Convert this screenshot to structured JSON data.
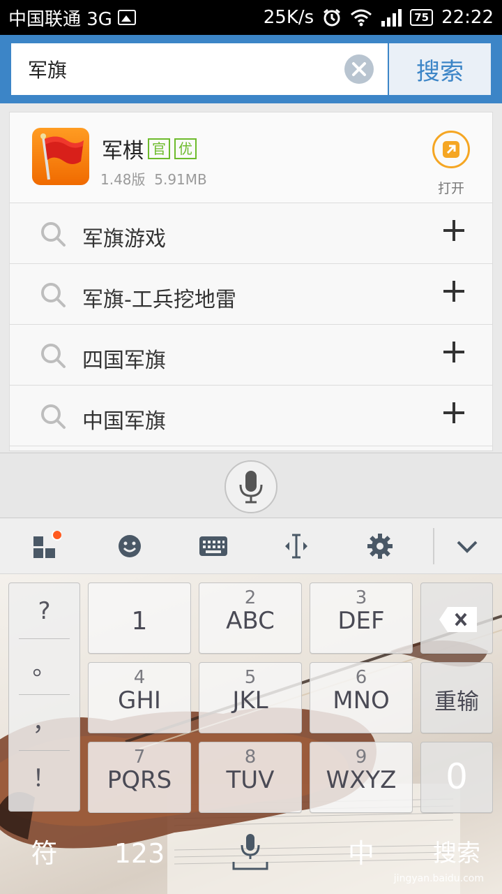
{
  "status_bar": {
    "carrier": "中国联通 3G",
    "speed": "25K/s",
    "battery": "75",
    "time": "22:22"
  },
  "search": {
    "query": "军旗",
    "button_label": "搜索"
  },
  "app_result": {
    "name": "军棋",
    "tags": [
      "官",
      "优"
    ],
    "version": "1.48版",
    "size": "5.91MB",
    "open_label": "打开"
  },
  "suggestions": [
    {
      "text": "军旗游戏"
    },
    {
      "text": "军旗-工兵挖地雷"
    },
    {
      "text": "四国军旗"
    },
    {
      "text": "中国军旗"
    }
  ],
  "keyboard": {
    "side_keys": [
      "?",
      "。",
      "，",
      "！"
    ],
    "keys": [
      {
        "num": "",
        "letters": "1"
      },
      {
        "num": "2",
        "letters": "ABC"
      },
      {
        "num": "3",
        "letters": "DEF"
      },
      {
        "num": "4",
        "letters": "GHI"
      },
      {
        "num": "5",
        "letters": "JKL"
      },
      {
        "num": "6",
        "letters": "MNO"
      },
      {
        "num": "7",
        "letters": "PQRS"
      },
      {
        "num": "8",
        "letters": "TUV"
      },
      {
        "num": "9",
        "letters": "WXYZ"
      }
    ],
    "retype_label": "重输",
    "zero_label": "0",
    "symbol_label": "符",
    "numbers_label": "123",
    "chinese_label": "中",
    "search_label": "搜索"
  },
  "watermark": "jingyan.baidu.com",
  "colors": {
    "header_blue": "#3c85c7",
    "tag_green": "#6dbb2c",
    "open_orange": "#f5a623",
    "badge_red": "#ff5a1f"
  }
}
